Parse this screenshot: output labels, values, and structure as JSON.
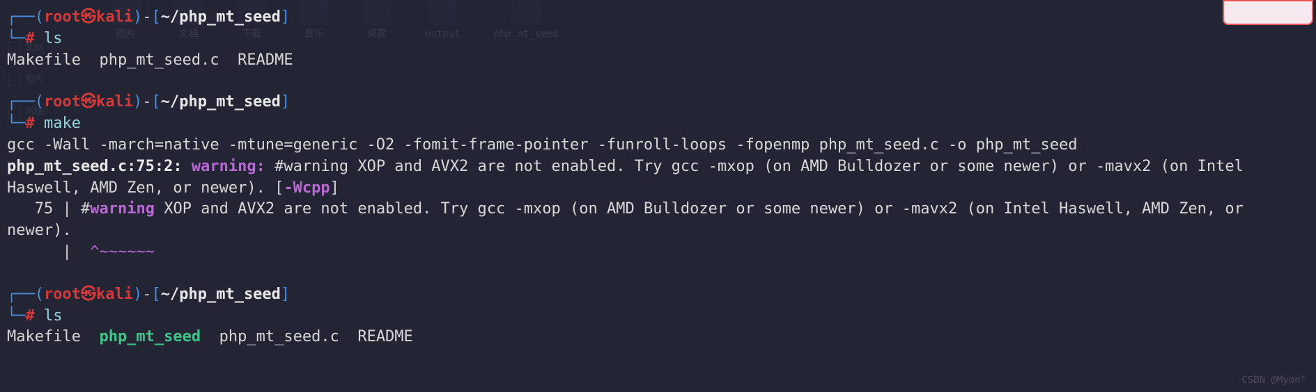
{
  "desktop": {
    "icons": [
      "图片",
      "文档",
      "下载",
      "音乐",
      "桌面",
      "output",
      "php_mt_seed"
    ]
  },
  "sidebar": {
    "items": [
      "文档",
      "图片",
      "网络"
    ]
  },
  "prompt": {
    "open_corner": "┌──",
    "lower_corner": "└─",
    "lparen": "(",
    "rparen": ")",
    "dash": "-",
    "lbracket": "[",
    "rbracket": "]",
    "user": "root",
    "skull": "㉿",
    "host": "kali",
    "path": "~/php_mt_seed",
    "hash": "#"
  },
  "block1": {
    "cmd": "ls",
    "output": "Makefile  php_mt_seed.c  README"
  },
  "block2": {
    "cmd": "make",
    "line_gcc": "gcc -Wall -march=native -mtune=generic -O2 -fomit-frame-pointer -funroll-loops -fopenmp php_mt_seed.c -o php_mt_seed",
    "warn_prefix": "php_mt_seed.c:75:2: ",
    "warn_label": "warning: ",
    "warn_msg": "#warning XOP and AVX2 are not enabled. Try gcc -mxop (on AMD Bulldozer or some newer) or -mavx2 (on Intel Haswell, AMD Zen, or newer). [",
    "warn_flag": "-Wcpp",
    "warn_close": "]",
    "src_lineno": "   75 | #",
    "src_warning": "warning",
    "src_rest": " XOP and AVX2 are not enabled. Try gcc -mxop (on AMD Bulldozer or some newer) or -mavx2 (on Intel Haswell, AMD Zen, or newer).",
    "src_caret_pre": "      |  ",
    "src_caret": "^~~~~~~"
  },
  "block3": {
    "cmd": "ls",
    "out_pre": "Makefile  ",
    "out_exe": "php_mt_seed",
    "out_post": "  php_mt_seed.c  README"
  },
  "watermark": "CSDN @Myon⁵"
}
